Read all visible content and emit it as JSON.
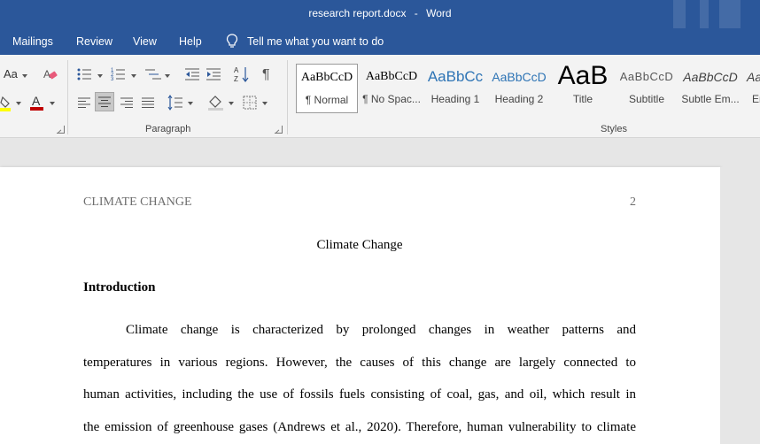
{
  "window": {
    "filename": "research report.docx",
    "separator": "-",
    "app": "Word"
  },
  "menu": {
    "tabs": [
      "Mailings",
      "Review",
      "View",
      "Help"
    ],
    "tell_me": "Tell me what you want to do"
  },
  "ribbon": {
    "font_size_label": "Aa",
    "paragraph_label": "Paragraph",
    "styles_label": "Styles",
    "styles": [
      {
        "preview": "AaBbCcD",
        "name": "¶ Normal"
      },
      {
        "preview": "AaBbCcD",
        "name": "¶ No Spac..."
      },
      {
        "preview": "AaBbCc",
        "name": "Heading 1"
      },
      {
        "preview": "AaBbCcD",
        "name": "Heading 2"
      },
      {
        "preview": "AaB",
        "name": "Title"
      },
      {
        "preview": "AaBbCcD",
        "name": "Subtitle"
      },
      {
        "preview": "AaBbCcD",
        "name": "Subtle Em..."
      },
      {
        "preview": "AaBbCcD",
        "name": "En"
      }
    ],
    "colors": {
      "highlight": "#ffff00",
      "font_color": "#c00000",
      "accent": "#2b579a"
    }
  },
  "document": {
    "running_head": "CLIMATE CHANGE",
    "page_number": "2",
    "title": "Climate Change",
    "section_heading": "Introduction",
    "lines": [
      "Climate change is characterized by prolonged changes in weather patterns and",
      "temperatures in various regions. However, the causes of this change are largely connected to",
      "human activities, including the use of fossils fuels consisting of coal, gas, and oil, which result in",
      "the emission of greenhouse gases (Andrews et al., 2020). Therefore, human vulnerability to climate"
    ]
  }
}
